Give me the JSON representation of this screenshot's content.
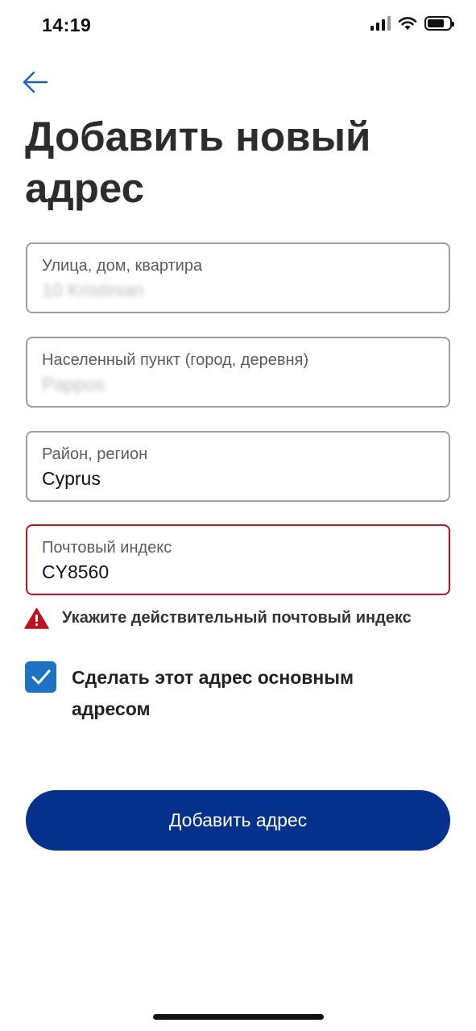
{
  "status": {
    "time": "14:19",
    "battery_level": 0.75
  },
  "header": {
    "title": "Добавить новый адрес"
  },
  "form": {
    "street": {
      "label": "Улица, дом, квартира",
      "value": "10 Kristinian"
    },
    "city": {
      "label": "Населенный пункт (город, деревня)",
      "value": "Pappos"
    },
    "region": {
      "label": "Район, регион",
      "value": "Cyprus"
    },
    "postal": {
      "label": "Почтовый индекс",
      "value": "CY8560"
    }
  },
  "error": {
    "message": "Укажите действительный почтовый индекс",
    "color": "#c0111f"
  },
  "default_address": {
    "label": "Сделать этот адрес основным адресом",
    "checked": true
  },
  "submit": {
    "label": "Добавить адрес"
  },
  "colors": {
    "accent": "#03318c",
    "checkbox": "#1d72c4",
    "error": "#c0111f"
  }
}
